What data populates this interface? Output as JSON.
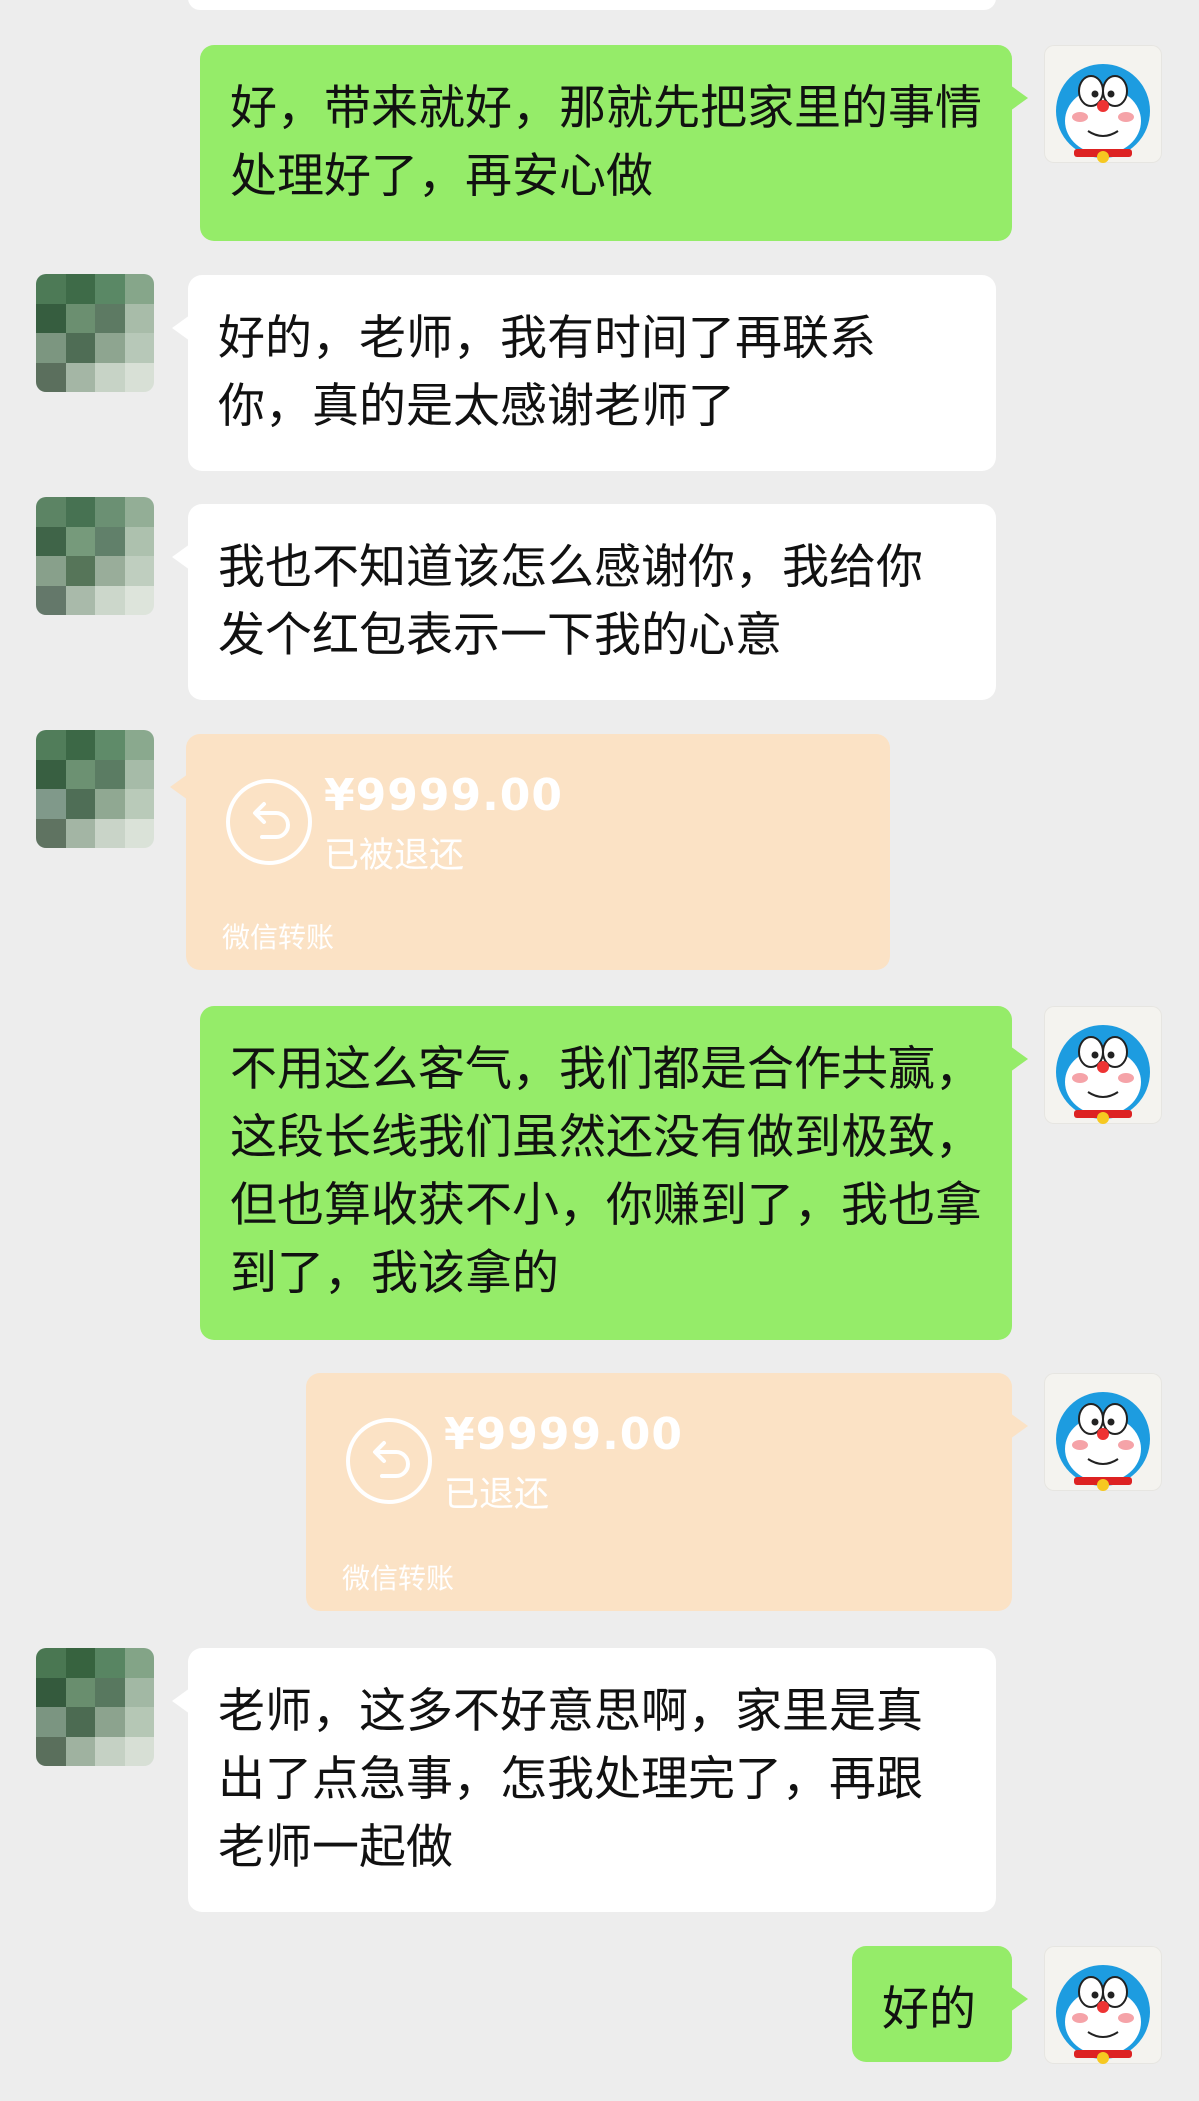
{
  "messages": [
    {
      "text": "好，带来就好，那就先把家里的事情处理好了，再安心做"
    },
    {
      "text": "好的，老师，我有时间了再联系你，真的是太感谢老师了"
    },
    {
      "text": "我也不知道该怎么感谢你，我给你发个红包表示一下我的心意"
    },
    {
      "amount": "¥9999.00",
      "status": "已被退还",
      "label": "微信转账"
    },
    {
      "text": "不用这么客气，我们都是合作共赢，这段长线我们虽然还没有做到极致，但也算收获不小，你赚到了，我也拿到了，我该拿的"
    },
    {
      "amount": "¥9999.00",
      "status": "已退还",
      "label": "微信转账"
    },
    {
      "text": "老师，这多不好意思啊，家里是真出了点急事，怎我处理完了，再跟老师一起做"
    },
    {
      "text": "好的"
    }
  ],
  "colors": {
    "background": "#ededed",
    "sent_bubble": "#95ec69",
    "received_bubble": "#ffffff",
    "transfer_card": "#fbe2c5"
  },
  "icons": {
    "sender_avatar": "doraemon-avatar",
    "contact_avatar": "pixelated-avatar",
    "transfer_return": "return-arrow-icon"
  }
}
